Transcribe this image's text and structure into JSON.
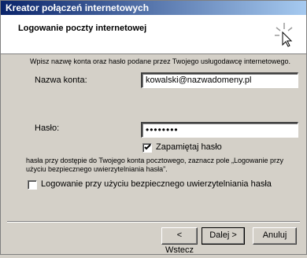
{
  "window": {
    "title": "Kreator połączeń internetowych"
  },
  "header": {
    "heading": "Logowanie poczty internetowej",
    "icon": "wizard-sparkle-icon"
  },
  "instructions": "Wpisz nazwę konta oraz hasło podane przez Twojego usługodawcę internetowego.",
  "account": {
    "label": "Nazwa konta:",
    "value": "kowalski@nazwadomeny.pl"
  },
  "password": {
    "label": "Hasło:",
    "value": "••••••••"
  },
  "remember_password": {
    "label": "Zapamiętaj hasło",
    "checked": true
  },
  "spa_note": "hasła przy dostępie do Twojego konta pocztowego, zaznacz pole „Logowanie przy użyciu bezpiecznego uwierzytelniania hasła”.",
  "spa_checkbox": {
    "label": "Logowanie przy użyciu bezpiecznego uwierzytelniania hasła",
    "checked": false
  },
  "buttons": {
    "back": "< Wstecz",
    "next": "Dalej >",
    "cancel": "Anuluj"
  }
}
